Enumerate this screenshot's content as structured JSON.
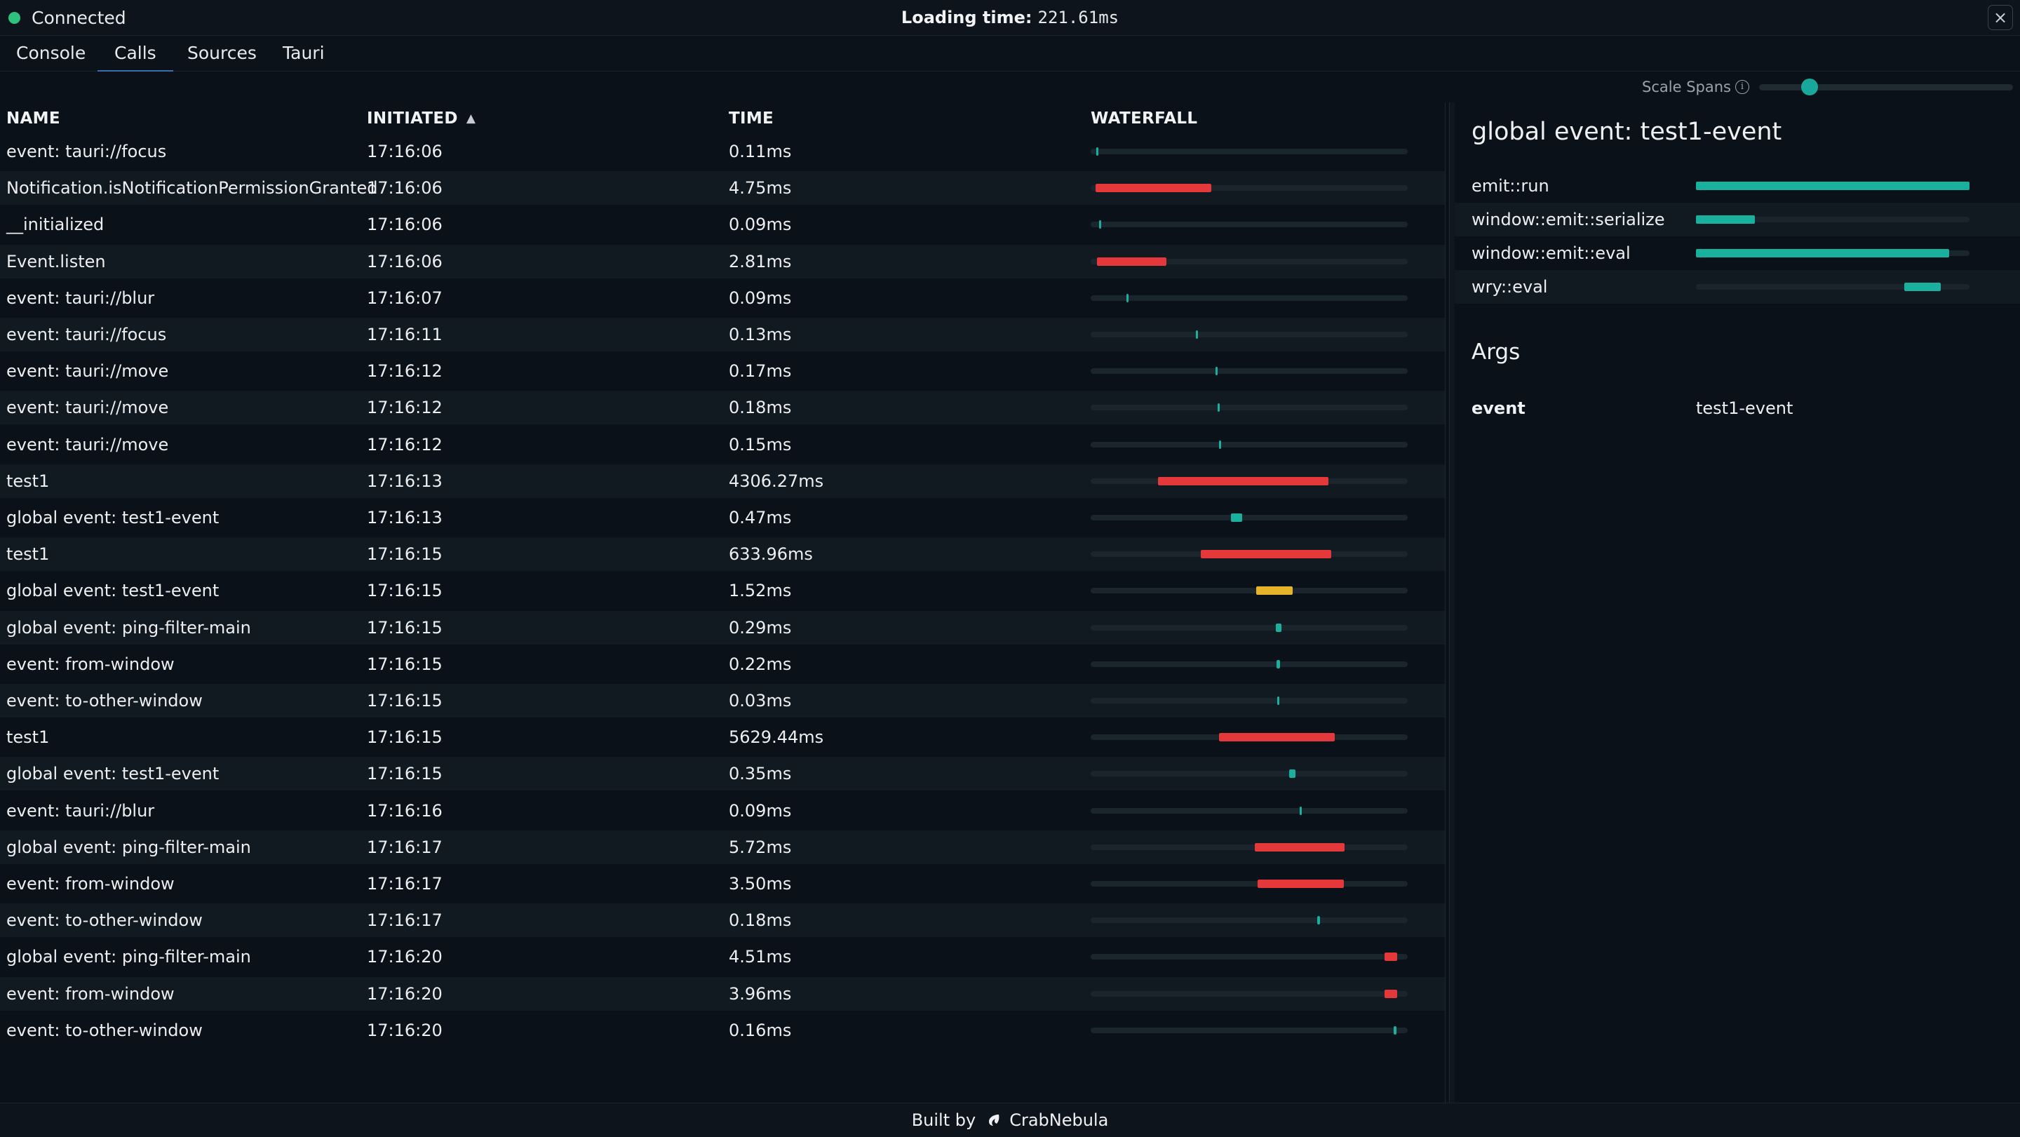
{
  "header": {
    "status": "Connected",
    "loading_label": "Loading time:",
    "loading_value": "221.61ms",
    "close_icon": "×"
  },
  "tabs": [
    {
      "label": "Console"
    },
    {
      "label": "Calls",
      "active": true
    },
    {
      "label": "Sources"
    },
    {
      "label": "Tauri"
    }
  ],
  "scale_spans": {
    "label": "Scale Spans",
    "info_icon": "i",
    "value_fraction": 0.2
  },
  "table": {
    "columns": {
      "name": "NAME",
      "initiated": "INITIATED",
      "time": "TIME",
      "waterfall": "WATERFALL"
    },
    "sort_icon": "▲",
    "rows": [
      {
        "name": "event: tauri://focus",
        "initiated": "17:16:06",
        "time": "0.11ms",
        "wf_start": 0.018,
        "wf_width": 0.006,
        "wf_color": "#19b09e"
      },
      {
        "name": "Notification.isNotificationPermissionGranted",
        "initiated": "17:16:06",
        "time": "4.75ms",
        "wf_start": 0.016,
        "wf_width": 0.365,
        "wf_color": "#e5383b"
      },
      {
        "name": "__initialized",
        "initiated": "17:16:06",
        "time": "0.09ms",
        "wf_start": 0.026,
        "wf_width": 0.005,
        "wf_color": "#19b09e"
      },
      {
        "name": "Event.listen",
        "initiated": "17:16:06",
        "time": "2.81ms",
        "wf_start": 0.02,
        "wf_width": 0.218,
        "wf_color": "#e5383b"
      },
      {
        "name": "event: tauri://blur",
        "initiated": "17:16:07",
        "time": "0.09ms",
        "wf_start": 0.113,
        "wf_width": 0.005,
        "wf_color": "#19b09e"
      },
      {
        "name": "event: tauri://focus",
        "initiated": "17:16:11",
        "time": "0.13ms",
        "wf_start": 0.332,
        "wf_width": 0.006,
        "wf_color": "#19b09e"
      },
      {
        "name": "event: tauri://move",
        "initiated": "17:16:12",
        "time": "0.17ms",
        "wf_start": 0.393,
        "wf_width": 0.008,
        "wf_color": "#19b09e"
      },
      {
        "name": "event: tauri://move",
        "initiated": "17:16:12",
        "time": "0.18ms",
        "wf_start": 0.4,
        "wf_width": 0.008,
        "wf_color": "#19b09e"
      },
      {
        "name": "event: tauri://move",
        "initiated": "17:16:12",
        "time": "0.15ms",
        "wf_start": 0.405,
        "wf_width": 0.007,
        "wf_color": "#19b09e"
      },
      {
        "name": "test1",
        "initiated": "17:16:13",
        "time": "4306.27ms",
        "wf_start": 0.212,
        "wf_width": 0.538,
        "wf_color": "#e5383b"
      },
      {
        "name": "global event: test1-event",
        "initiated": "17:16:13",
        "time": "0.47ms",
        "wf_start": 0.442,
        "wf_width": 0.035,
        "wf_color": "#19b09e"
      },
      {
        "name": "test1",
        "initiated": "17:16:15",
        "time": "633.96ms",
        "wf_start": 0.347,
        "wf_width": 0.411,
        "wf_color": "#e5383b"
      },
      {
        "name": "global event: test1-event",
        "initiated": "17:16:15",
        "time": "1.52ms",
        "wf_start": 0.522,
        "wf_width": 0.115,
        "wf_color": "#e5b42a"
      },
      {
        "name": "global event: ping-filter-main",
        "initiated": "17:16:15",
        "time": "0.29ms",
        "wf_start": 0.585,
        "wf_width": 0.016,
        "wf_color": "#19b09e"
      },
      {
        "name": "event: from-window",
        "initiated": "17:16:15",
        "time": "0.22ms",
        "wf_start": 0.586,
        "wf_width": 0.012,
        "wf_color": "#19b09e"
      },
      {
        "name": "event: to-other-window",
        "initiated": "17:16:15",
        "time": "0.03ms",
        "wf_start": 0.588,
        "wf_width": 0.003,
        "wf_color": "#19b09e"
      },
      {
        "name": "test1",
        "initiated": "17:16:15",
        "time": "5629.44ms",
        "wf_start": 0.405,
        "wf_width": 0.365,
        "wf_color": "#e5383b"
      },
      {
        "name": "global event: test1-event",
        "initiated": "17:16:15",
        "time": "0.35ms",
        "wf_start": 0.626,
        "wf_width": 0.02,
        "wf_color": "#19b09e"
      },
      {
        "name": "event: tauri://blur",
        "initiated": "17:16:16",
        "time": "0.09ms",
        "wf_start": 0.66,
        "wf_width": 0.005,
        "wf_color": "#19b09e"
      },
      {
        "name": "global event: ping-filter-main",
        "initiated": "17:16:17",
        "time": "5.72ms",
        "wf_start": 0.518,
        "wf_width": 0.283,
        "wf_color": "#e5383b"
      },
      {
        "name": "event: from-window",
        "initiated": "17:16:17",
        "time": "3.50ms",
        "wf_start": 0.527,
        "wf_width": 0.272,
        "wf_color": "#e5383b"
      },
      {
        "name": "event: to-other-window",
        "initiated": "17:16:17",
        "time": "0.18ms",
        "wf_start": 0.714,
        "wf_width": 0.009,
        "wf_color": "#19b09e"
      },
      {
        "name": "global event: ping-filter-main",
        "initiated": "17:16:20",
        "time": "4.51ms",
        "wf_start": 0.927,
        "wf_width": 0.04,
        "wf_color": "#e5383b"
      },
      {
        "name": "event: from-window",
        "initiated": "17:16:20",
        "time": "3.96ms",
        "wf_start": 0.927,
        "wf_width": 0.04,
        "wf_color": "#e5383b"
      },
      {
        "name": "event: to-other-window",
        "initiated": "17:16:20",
        "time": "0.16ms",
        "wf_start": 0.956,
        "wf_width": 0.009,
        "wf_color": "#19b09e"
      }
    ]
  },
  "detail": {
    "title": "global event: test1-event",
    "spans": [
      {
        "name": "emit::run",
        "start": 0.0,
        "width": 1.0
      },
      {
        "name": "window::emit::serialize",
        "start": 0.0,
        "width": 0.215
      },
      {
        "name": "window::emit::eval",
        "start": 0.0,
        "width": 0.925
      },
      {
        "name": "wry::eval",
        "start": 0.762,
        "width": 0.133
      }
    ],
    "args_title": "Args",
    "args": [
      {
        "key": "event",
        "value": "test1-event"
      }
    ]
  },
  "footer": {
    "built_by": "Built by",
    "brand": "CrabNebula",
    "logo_icon": "crabnebula-logo-icon"
  },
  "colors": {
    "accent": "#19b09e",
    "error": "#e5383b",
    "warning": "#e5b42a",
    "connected": "#2ec27e",
    "tab_underline": "#3a6eb0"
  }
}
